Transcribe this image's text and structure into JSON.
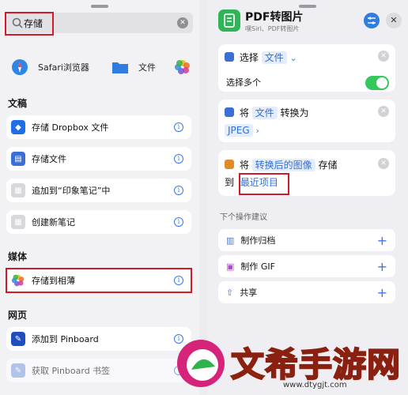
{
  "left": {
    "search": {
      "query": "存储"
    },
    "quick": [
      {
        "label": "Safari浏览器",
        "icon": "safari-icon"
      },
      {
        "label": "文件",
        "icon": "folder-icon"
      },
      {
        "label": "",
        "icon": "photos-icon"
      }
    ],
    "sections": {
      "docs": "文稿",
      "media": "媒体",
      "web": "网页"
    },
    "doc_items": [
      "存储 Dropbox 文件",
      "存储文件",
      "追加到“印象笔记”中",
      "创建新笔记"
    ],
    "media_items": [
      "存储到相薄"
    ],
    "web_items": [
      "添加到 Pinboard",
      "获取 Pinboard 书签"
    ],
    "info_glyph": "i"
  },
  "right": {
    "title": "PDF转图片",
    "subtitle": "嘿Siri、PDF转图片",
    "card1": {
      "verb": "选择",
      "var": "文件",
      "multi": "选择多个"
    },
    "card2": {
      "verb": "将",
      "var": "文件",
      "middle": "转换为",
      "format": "JPEG"
    },
    "card3": {
      "verb": "将",
      "var": "转换后的图像",
      "action": "存储",
      "to": "到",
      "target": "最近项目"
    },
    "suggest_title": "下个操作建议",
    "suggestions": [
      "制作归档",
      "制作 GIF",
      "共享"
    ]
  },
  "watermark": {
    "text": "文希手游网",
    "url": "www.dtygjt.com"
  },
  "colors": {
    "accent": "#3478f6",
    "highlight_border": "#d21a2a",
    "toggle_on": "#34c759",
    "app_green": "#2fb557"
  }
}
